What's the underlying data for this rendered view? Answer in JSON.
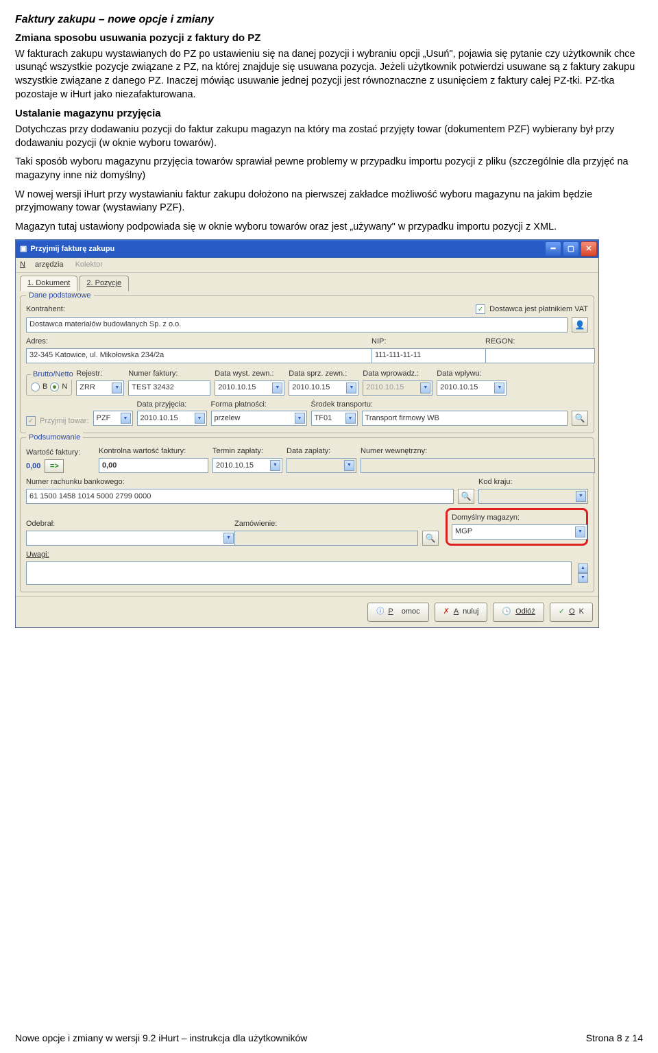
{
  "content": {
    "heading": "Faktury zakupu – nowe opcje i zmiany",
    "sub1_title": "Zmiana sposobu usuwania pozycji z faktury do PZ",
    "sub1_p1": "W fakturach zakupu wystawianych do PZ po ustawieniu się na danej pozycji i wybraniu opcji „Usuń\", pojawia się pytanie czy użytkownik chce usunąć wszystkie pozycje związane z PZ, na której znajduje się usuwana pozycja. Jeżeli użytkownik potwierdzi usuwane są  z faktury zakupu wszystkie związane z danego PZ. Inaczej mówiąc usuwanie jednej pozycji jest równoznaczne z usunięciem z faktury całej PZ-tki. PZ-tka pozostaje w iHurt jako niezafakturowana.",
    "sub2_title": "Ustalanie magazynu przyjęcia",
    "sub2_p1": "Dotychczas przy dodawaniu pozycji do faktur zakupu magazyn na który ma zostać przyjęty towar (dokumentem PZF) wybierany był przy dodawaniu pozycji (w oknie wyboru towarów).",
    "sub2_p2": "Taki sposób wyboru magazynu przyjęcia towarów sprawiał pewne problemy w przypadku importu pozycji z pliku (szczególnie dla przyjęć na magazyny inne niż domyślny)",
    "sub2_p3": "W nowej wersji iHurt przy wystawianiu faktur zakupu dołożono na pierwszej zakładce możliwość wyboru magazynu na jakim będzie przyjmowany towar (wystawiany PZF).",
    "sub2_p4": "Magazyn tutaj ustawiony podpowiada się w oknie wyboru towarów oraz jest „używany\" w przypadku importu pozycji z XML."
  },
  "dialog": {
    "title": "Przyjmij fakturę zakupu",
    "menu": {
      "narzedzia": "Narzędzia",
      "kolektor": "Kolektor"
    },
    "tabs": {
      "t1": "1. Dokument",
      "t2": "2. Pozycje"
    },
    "grp_dane": "Dane podstawowe",
    "grp_podsum": "Podsumowanie",
    "kontrahent_lbl": "Kontrahent:",
    "kontrahent_val": "Dostawca materiałów budowlanych Sp. z o.o.",
    "dostawca_vat": "Dostawca jest płatnikiem VAT",
    "adres_lbl": "Adres:",
    "adres_val": "32-345 Katowice, ul. Mikołowska 234/2a",
    "nip_lbl": "NIP:",
    "nip_val": "111-111-11-11",
    "regon_lbl": "REGON:",
    "regon_val": "",
    "brutto_netto_lbl": "Brutto/Netto",
    "b_lbl": "B",
    "n_lbl": "N",
    "rejestr_lbl": "Rejestr:",
    "rejestr_val": "ZRR",
    "numer_lbl": "Numer faktury:",
    "numer_val": "TEST 32432",
    "dwyst_lbl": "Data wyst. zewn.:",
    "dsprz_lbl": "Data sprz. zewn.:",
    "dwprow_lbl": "Data wprowadz.:",
    "dwplyw_lbl": "Data wpływu:",
    "date_val": "2010.10.15",
    "date_disabled": "2010.10.15",
    "przyjmij_lbl": "Przyjmij towar:",
    "przyjmij_val": "PZF",
    "dprzyjecia_lbl": "Data przyjęcia:",
    "forma_lbl": "Forma płatności:",
    "forma_val": "przelew",
    "srodek_lbl": "Środek transportu:",
    "srodek_val": "TF01",
    "srodek_desc": "Transport  firmowy WB",
    "wartfak_lbl": "Wartość faktury:",
    "wartfak_val": "0,00",
    "kontrwart_lbl": "Kontrolna wartość faktury:",
    "kontrwart_val": "0,00",
    "termin_lbl": "Termin zapłaty:",
    "dzapl_lbl": "Data zapłaty:",
    "nrwewn_lbl": "Numer wewnętrzny:",
    "nrwewn_val": "",
    "nrrach_lbl": "Numer rachunku bankowego:",
    "nrrach_val": "61 1500 1458 1014 5000 2799 0000",
    "kodkraju_lbl": "Kod kraju:",
    "kodkraju_val": "",
    "odebral_lbl": "Odebrał:",
    "odebral_val": "",
    "zamowienie_lbl": "Zamówienie:",
    "zamowienie_val": "",
    "domag_lbl": "Domyślny magazyn:",
    "domag_val": "MGP",
    "uwagi_lbl": "Uwagi:",
    "btn_pomoc": "Pomoc",
    "btn_anuluj": "Anuluj",
    "btn_odloz": "Odłóż",
    "btn_ok": "OK"
  },
  "footer": {
    "left": "Nowe opcje i zmiany w wersji 9.2 iHurt – instrukcja dla użytkowników",
    "right": "Strona 8 z 14"
  }
}
